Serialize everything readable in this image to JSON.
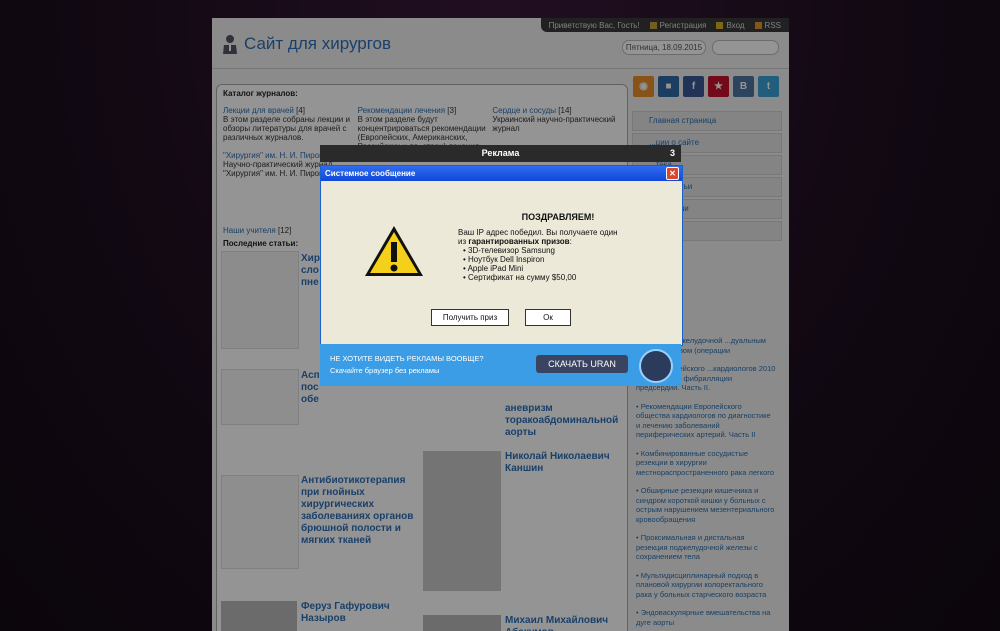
{
  "site": {
    "title": "Сайт для хирургов",
    "date": "Пятница, 18.09.2015"
  },
  "topbar": {
    "greeting": "Приветствую Вас, Гость!",
    "register": "Регистрация",
    "login": "Вход",
    "rss": "RSS"
  },
  "catalog": {
    "heading": "Каталог журналов:",
    "col1_link": "Лекции для врачей",
    "col1_count": "[4]",
    "col1_text": "В этом разделе собраны лекции и обзоры литературы для врачей с различных журналов.",
    "col1_link2": "\"Хирургия\" им. Н. И. Пирогова",
    "col1_text2": "Научно-практический журнал \"Хирургия\" им. Н. И. Пирогова",
    "col2_link": "Рекомендации лечения",
    "col2_count": "[3]",
    "col2_text": "В этом разделе будут концентрироваться рекомендации (Европейских, Американских, Российских и др. стран) лечения.",
    "col3_link": "Сердце и сосуды",
    "col3_count": "[14]",
    "col3_text": "Украинский научно-практический журнал",
    "teachers": "Наши учителя",
    "teachers_count": "[12]",
    "latest": "Последние статьи:"
  },
  "articles": {
    "a1": "Хиру сло пне",
    "a2": "Аспе пос обе",
    "a3": "аневризм торакоабдоминальной аорты",
    "a4": "Антибиотикотерапия при гнойных хирургических заболеваниях органов брюшной полости и мягких тканей",
    "a5": "Николай Николаевич Каншин",
    "a6": "Феруз Гафурович Назыров",
    "a7": "Михаил Михайлович Абакумов"
  },
  "menu": [
    "Главная страница",
    "...ции о сайте",
    "...тека",
    "...ые статьи",
    "...хирургии",
    "...за"
  ],
  "right_list": [
    "...еловки поджелудочной ...дуальным ...ианастомозом (операции",
    "...ции Европейского ...кардиологов 2010 г по лечению фибрилляции предсердий. Часть II.",
    "• Рекомендации Европейского общества кардиологов по диагностике и лечению заболеваний периферических артерий. Часть II",
    "• Комбинированные сосудистые резекции в хирургии местнораспространенного рака легкого",
    "• Обширные резекции кишечника и синдром короткой кишки у больных с острым нарушением мезентериального кровообращения",
    "• Проксимальная и дистальная резекция поджелудочной железы с сохранением тела",
    "• Мультидисциплинарный подход в плановой хирургии колоректального рака у больных старческого возраста",
    "• Эндоваскулярные вмешательства на дуге аорты"
  ],
  "ad": {
    "header": "Реклама",
    "counter": "3"
  },
  "dialog": {
    "title": "Системное сообщение",
    "heading": "ПОЗДРАВЛЯЕМ!",
    "line1": "Ваш IP адрес победил. Вы получаете один",
    "line2_pre": "из ",
    "line2_bold": "гарантированных призов",
    "line2_post": ":",
    "prizes": [
      "• 3D-телевизор Samsung",
      "• Ноутбук Dell Inspiron",
      "• Apple iPad Mini",
      "• Сертификат на сумму $50,00"
    ],
    "get_prize": "Получить приз",
    "ok": "Ок"
  },
  "promo": {
    "line1": "НЕ ХОТИТЕ ВИДЕТЬ РЕКЛАМЫ ВООБЩЕ?",
    "line2": "Скачайте браузер без рекламы",
    "download": "СКАЧАТЬ URAN"
  }
}
